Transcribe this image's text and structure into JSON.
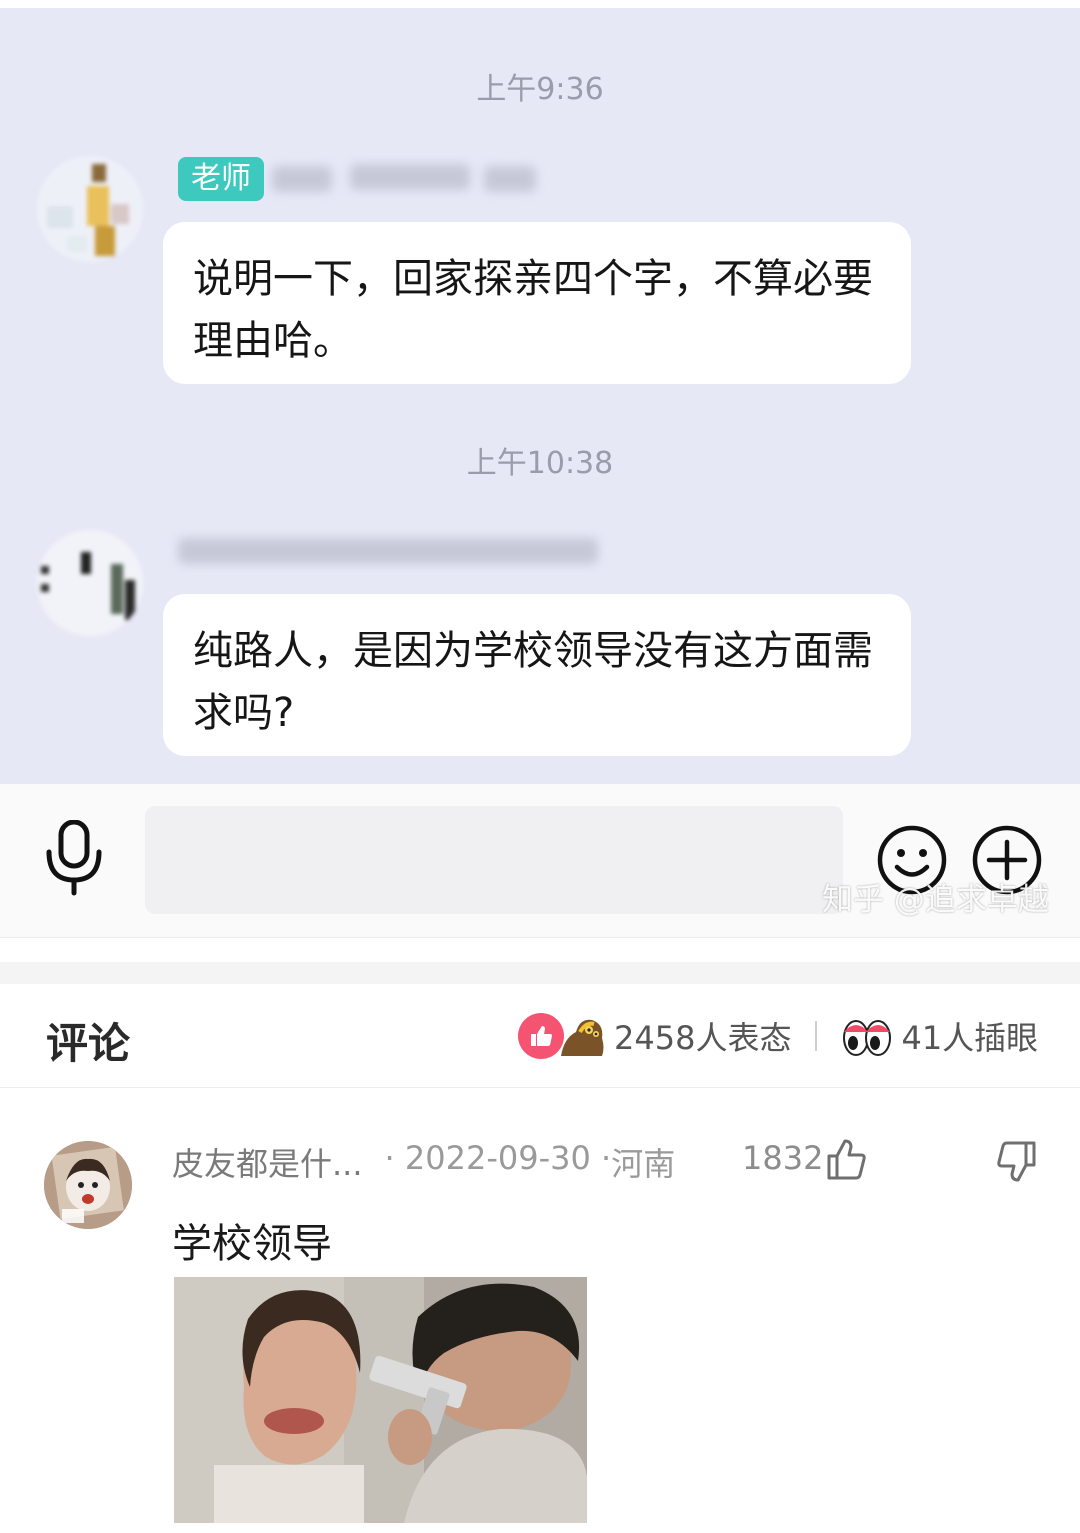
{
  "chat": {
    "time1": "上午9:36",
    "teacher_tag": "老师",
    "msg1": "说明一下，回家探亲四个字，不算必要理由哈。",
    "time2": "上午10:38",
    "msg2": "纯路人，是因为学校领导没有这方面需求吗?"
  },
  "watermark": "知乎 @追求卓越",
  "comments": {
    "title": "评论",
    "reactions_count": "2458人表态",
    "eyes_count": "41人插眼"
  },
  "comment": {
    "user": "皮友都是什...",
    "date": "· 2022-09-30 · ",
    "location": "河南",
    "likes": "1832",
    "text": "学校领导"
  },
  "colors": {
    "chat_bg": "#e6e8f6",
    "teacher_tag": "#3dc9bd",
    "like_badge": "#f45472"
  },
  "icons": [
    "microphone-icon",
    "emoji-icon",
    "plus-icon",
    "thumbs-up-icon",
    "thumbs-down-icon",
    "mud-reaction-icon",
    "eyes-reaction-icon"
  ]
}
